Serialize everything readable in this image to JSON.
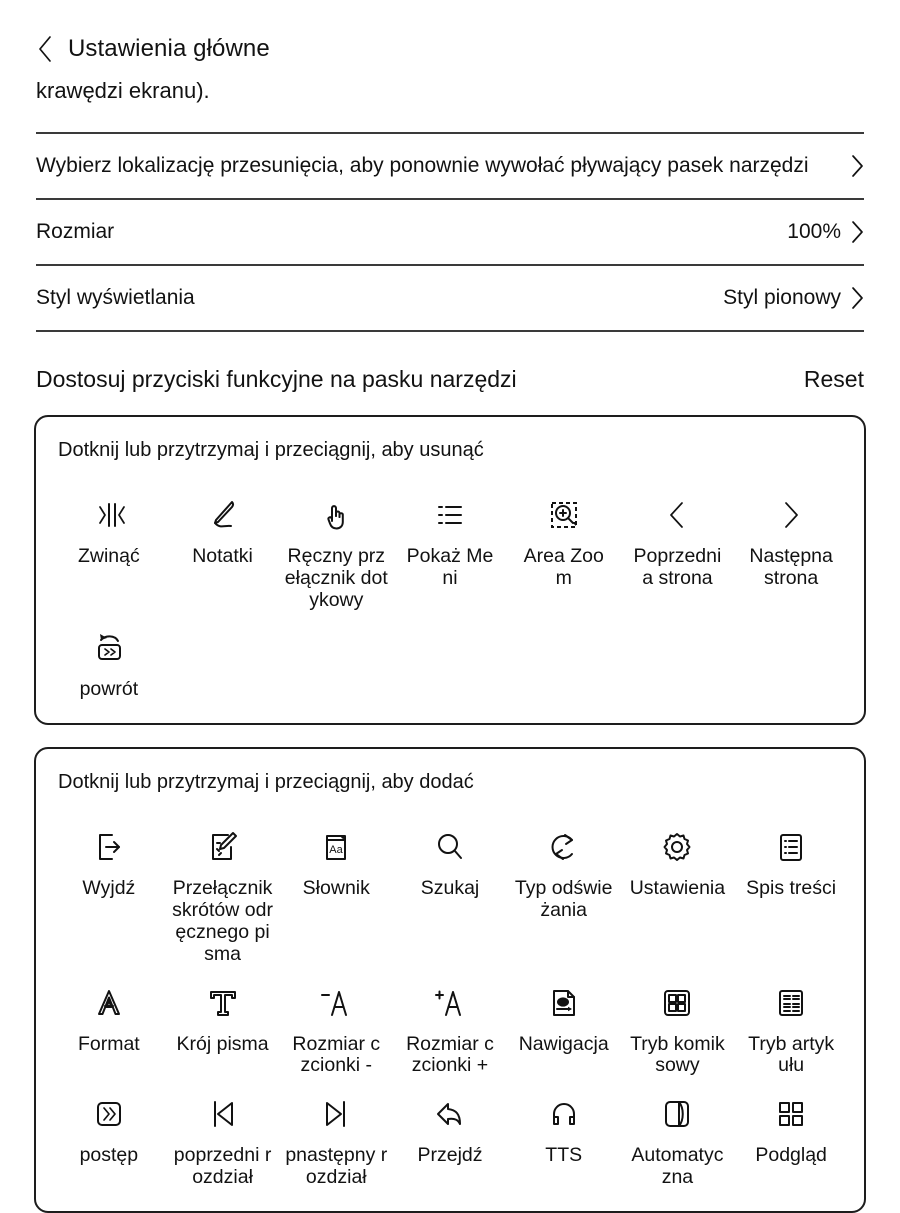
{
  "header": {
    "back_icon": "chevron-left-icon",
    "title": "Ustawienia główne",
    "continued_text": "krawędzi ekranu)."
  },
  "settings_rows": [
    {
      "label": "Wybierz lokalizację przesunięcia, aby ponownie wywołać pływający pasek narzędzi",
      "value": "",
      "chevron": "chevron-right-icon"
    },
    {
      "label": "Rozmiar",
      "value": "100%",
      "chevron": "chevron-right-icon"
    },
    {
      "label": "Styl wyświetlania",
      "value": "Styl pionowy",
      "chevron": "chevron-right-icon"
    }
  ],
  "customize_section": {
    "title": "Dostosuj przyciski funkcyjne na pasku narzędzi",
    "reset_label": "Reset"
  },
  "remove_panel": {
    "hint": "Dotknij lub przytrzymaj i przeciągnij, aby usunąć",
    "items": [
      {
        "label": "Zwinąć",
        "icon": "collapse-icon"
      },
      {
        "label": "Notatki",
        "icon": "pen-note-icon"
      },
      {
        "label": "Ręczny przełącznik dotykowy",
        "icon": "hand-touch-icon"
      },
      {
        "label": "Pokaż Meni",
        "icon": "list-menu-icon"
      },
      {
        "label": "Area Zoom",
        "icon": "area-zoom-icon"
      },
      {
        "label": "Poprzednia strona",
        "icon": "chevron-left-icon"
      },
      {
        "label": "Następna strona",
        "icon": "chevron-right-icon"
      },
      {
        "label": "powrót",
        "icon": "return-back-icon"
      }
    ]
  },
  "add_panel": {
    "hint": "Dotknij lub przytrzymaj i przeciągnij, aby dodać",
    "items": [
      {
        "label": "Wyjdź",
        "icon": "exit-icon"
      },
      {
        "label": "Przełącznik skrótów odręcznego pisma",
        "icon": "handwriting-shortcut-icon"
      },
      {
        "label": "Słownik",
        "icon": "dictionary-icon"
      },
      {
        "label": "Szukaj",
        "icon": "search-icon"
      },
      {
        "label": "Typ odświeżania",
        "icon": "refresh-type-icon"
      },
      {
        "label": "Ustawienia",
        "icon": "gear-icon"
      },
      {
        "label": "Spis treści",
        "icon": "table-of-contents-icon"
      },
      {
        "label": "Format",
        "icon": "format-a-icon"
      },
      {
        "label": "Krój pisma",
        "icon": "typeface-t-icon"
      },
      {
        "label": "Rozmiar czcionki -",
        "icon": "font-size-decrease-icon"
      },
      {
        "label": "Rozmiar czcionki +",
        "icon": "font-size-increase-icon"
      },
      {
        "label": "Nawigacja",
        "icon": "navigation-doc-icon"
      },
      {
        "label": "Tryb komiksowy",
        "icon": "comic-mode-icon"
      },
      {
        "label": "Tryb artykułu",
        "icon": "article-mode-icon"
      },
      {
        "label": "postęp",
        "icon": "progress-icon"
      },
      {
        "label": "poprzedni rozdział",
        "icon": "previous-chapter-icon"
      },
      {
        "label": "pnastępny rozdział",
        "icon": "next-chapter-icon"
      },
      {
        "label": "Przejdź",
        "icon": "goto-arrow-icon"
      },
      {
        "label": "TTS",
        "icon": "headphones-icon"
      },
      {
        "label": "Automatyczna",
        "icon": "auto-page-turn-icon"
      },
      {
        "label": "Podgląd",
        "icon": "preview-grid-icon"
      }
    ]
  },
  "colors": {
    "background": "#ffffff",
    "text": "#121212",
    "divider": "#3a3a3a",
    "panel_border": "#1d1d1d"
  }
}
